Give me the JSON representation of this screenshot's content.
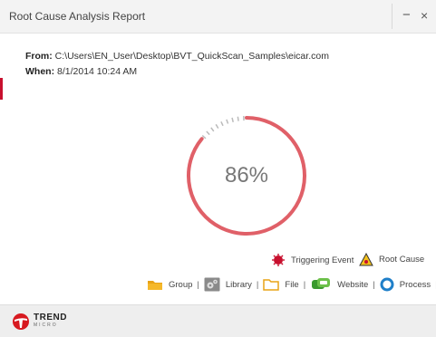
{
  "window": {
    "title": "Root Cause Analysis Report",
    "minimize_label": "−",
    "close_label": "×"
  },
  "info": {
    "from_label": "From:",
    "from_value": "C:\\Users\\EN_User\\Desktop\\BVT_QuickScan_Samples\\eicar.com",
    "when_label": "When:",
    "when_value": "8/1/2014 10:24 AM"
  },
  "progress": {
    "percent": 86,
    "label": "86%"
  },
  "legend": {
    "triggering_event": "Triggering Event",
    "root_cause": "Root Cause",
    "group": "Group",
    "library": "Library",
    "file": "File",
    "website": "Website",
    "process": "Process",
    "separator": "|"
  },
  "footer": {
    "brand": "TREND",
    "brand_sub": "MICRO"
  },
  "colors": {
    "progress": "#e06068",
    "brand_red": "#d71920",
    "title_bar": "#f3f3f3"
  }
}
